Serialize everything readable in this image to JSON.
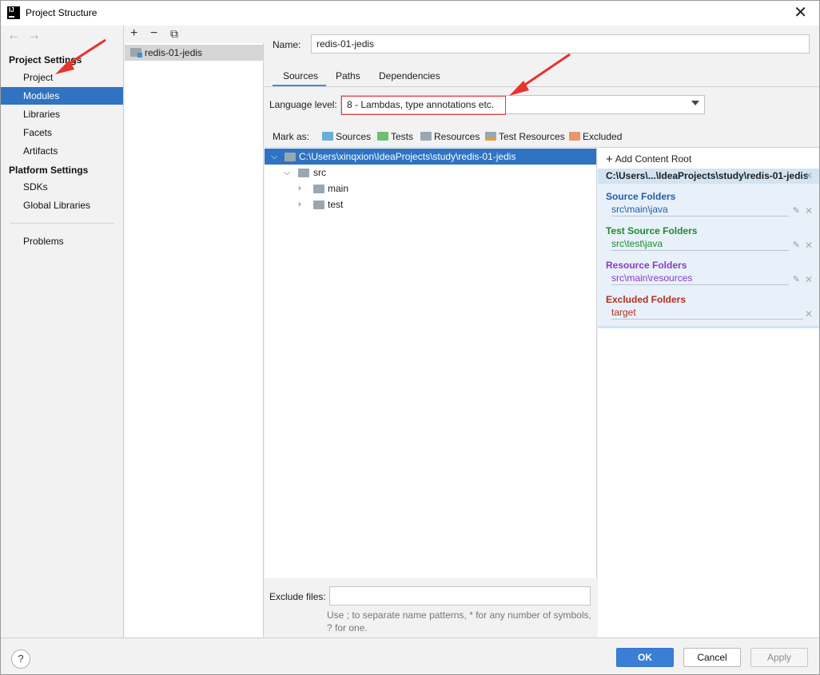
{
  "window": {
    "title": "Project Structure"
  },
  "nav": {
    "project_settings": "Project Settings",
    "items_ps": [
      "Project",
      "Modules",
      "Libraries",
      "Facets",
      "Artifacts"
    ],
    "platform_settings": "Platform Settings",
    "items_pl": [
      "SDKs",
      "Global Libraries"
    ],
    "problems": "Problems"
  },
  "modules": {
    "tools": [
      "+",
      "−",
      "⧉"
    ],
    "items": [
      "redis-01-jedis"
    ]
  },
  "main": {
    "name_label": "Name:",
    "name_value": "redis-01-jedis",
    "tabs": [
      "Sources",
      "Paths",
      "Dependencies"
    ],
    "language_label": "Language level:",
    "language_value": "8 - Lambdas, type annotations etc.",
    "mark_as_label": "Mark as:",
    "mark_as": [
      {
        "label": "Sources",
        "color": "#6aaed6"
      },
      {
        "label": "Tests",
        "color": "#6fbf73"
      },
      {
        "label": "Resources",
        "color": "#9aa7b0"
      },
      {
        "label": "Test Resources",
        "color": "#9aa7b0"
      },
      {
        "label": "Excluded",
        "color": "#e8956b"
      }
    ],
    "tree": {
      "root": "C:\\Users\\xinqxion\\IdeaProjects\\study\\redis-01-jedis",
      "src": "src",
      "main": "main",
      "test": "test"
    },
    "exclude_label": "Exclude files:",
    "exclude_value": "",
    "exclude_hint": "Use ; to separate name patterns, * for any number of symbols, ? for one."
  },
  "roots": {
    "add_label": "Add Content Root",
    "path": "C:\\Users\\...\\IdeaProjects\\study\\redis-01-jedis",
    "source_head": "Source Folders",
    "source_path": "src\\main\\java",
    "test_head": "Test Source Folders",
    "test_path": "src\\test\\java",
    "resource_head": "Resource Folders",
    "resource_path": "src\\main\\resources",
    "excluded_head": "Excluded Folders",
    "excluded_path": "target",
    "colors": {
      "source": "#1f5ea8",
      "test": "#1c8a2e",
      "resource": "#8a3bc6",
      "excluded": "#b03020"
    }
  },
  "footer": {
    "help": "?",
    "ok": "OK",
    "cancel": "Cancel",
    "apply": "Apply"
  }
}
